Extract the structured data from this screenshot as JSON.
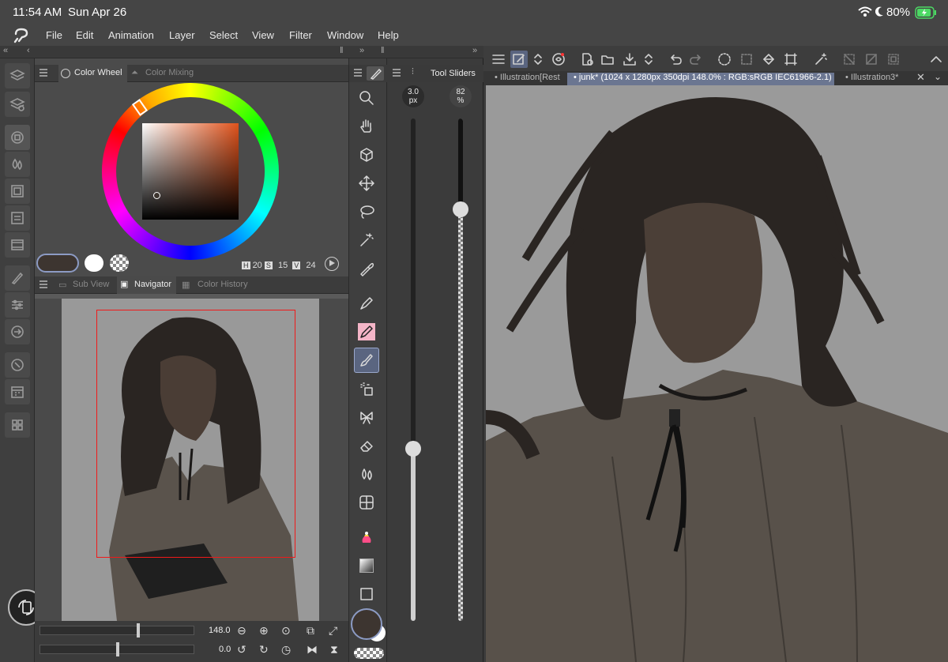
{
  "status": {
    "time": "11:54 AM",
    "date": "Sun Apr 26",
    "battery": "80%"
  },
  "menu": [
    "File",
    "Edit",
    "Animation",
    "Layer",
    "Select",
    "View",
    "Filter",
    "Window",
    "Help"
  ],
  "color_panel": {
    "tabs": [
      "Color Wheel",
      "Color Mixing"
    ],
    "hsv": {
      "h_label": "H",
      "h": "20",
      "s_label": "S",
      "s": "15",
      "v_label": "V",
      "v": "24"
    },
    "accent": "#6b7691"
  },
  "navigator_panel": {
    "tabs": [
      "Sub View",
      "Navigator",
      "Color History"
    ],
    "zoom": "148.0",
    "rotation": "0.0"
  },
  "tool_sliders": {
    "title": "Tool Sliders",
    "size": "3.0",
    "size_unit": "px",
    "opacity": "82",
    "opacity_unit": "%"
  },
  "doc_tabs": [
    "Illustration[Rest",
    "junk* (1024 x 1280px 350dpi 148.0% : RGB:sRGB IEC61966-2.1)",
    "Illustration3*"
  ],
  "icons": {
    "left": [
      "layers-icon",
      "layer-property-icon",
      "color-wheel-icon",
      "color-mixing-icon",
      "color-set-icon",
      "material-icon",
      "timeline-icon",
      "tool-property-icon",
      "sub-tool-detail-icon",
      "auto-action-icon",
      "navigator-icon",
      "history-icon",
      "quick-access-icon"
    ],
    "tools": [
      "zoom-icon",
      "hand-icon",
      "3d-icon",
      "move-icon",
      "lasso-icon",
      "magic-wand-icon",
      "eyedropper-icon",
      "pen-icon",
      "pencil-icon",
      "brush-icon",
      "airbrush-icon",
      "decoration-icon",
      "eraser-icon",
      "blend-icon",
      "figure-icon",
      "fill-icon",
      "gradient-icon",
      "frame-icon"
    ]
  }
}
